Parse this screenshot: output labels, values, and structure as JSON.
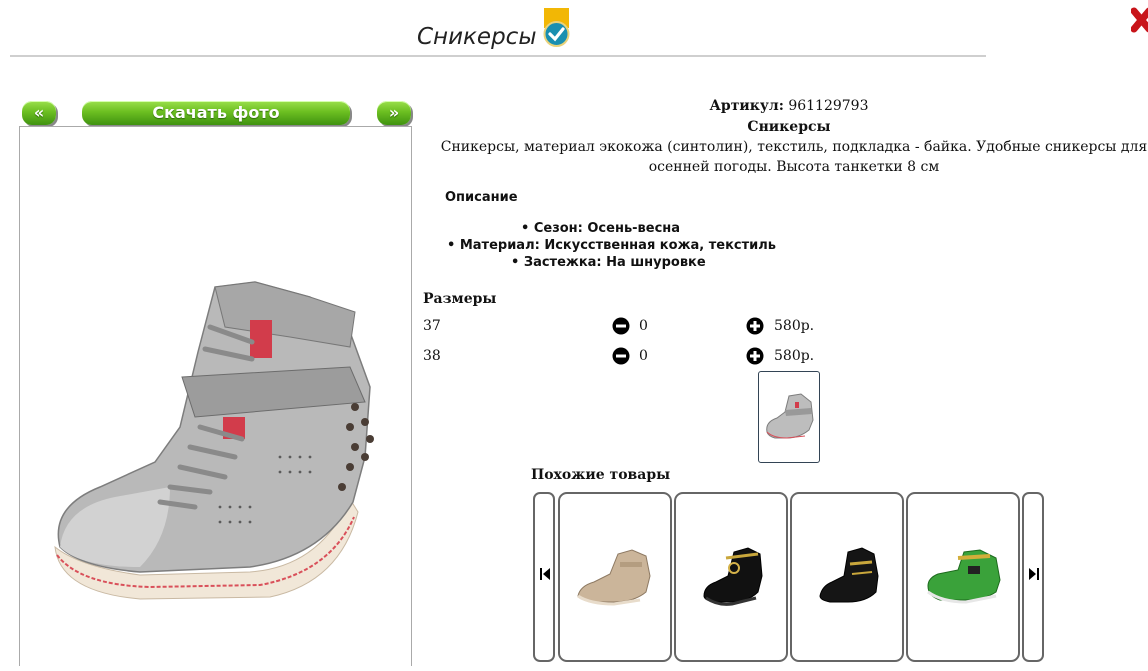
{
  "header": {
    "title": "Сникерсы"
  },
  "photo_nav": {
    "prev_label": "«",
    "download_label": "Скачать фото",
    "next_label": "»"
  },
  "product": {
    "article_label": "Артикул:",
    "article_value": "961129793",
    "name": "Сникерсы",
    "description": "Сникерсы, материал экокожа (синтолин), текстиль, подкладка - байка. Удобные сникерсы для осенней погоды. Высота танкетки 8 см"
  },
  "description_block": {
    "heading": "Описание",
    "features": [
      "• Сезон: Осень-весна",
      "• Материал: Искусственная кожа, текстиль",
      "• Застежка: На шнуровке"
    ]
  },
  "sizes": {
    "heading": "Размеры",
    "rows": [
      {
        "size": "37",
        "qty": "0",
        "price": "580р."
      },
      {
        "size": "38",
        "qty": "0",
        "price": "580р."
      }
    ]
  },
  "similar": {
    "heading": "Похожие товары"
  },
  "colors": {
    "accent_green": "#6cbf21",
    "close_red": "#d11"
  },
  "icons": {
    "verified": "check-badge-icon",
    "close": "close-x-icon",
    "minus": "minus-circle-icon",
    "plus": "plus-circle-icon",
    "carousel_prev": "carousel-prev-icon",
    "carousel_next": "carousel-next-icon"
  }
}
